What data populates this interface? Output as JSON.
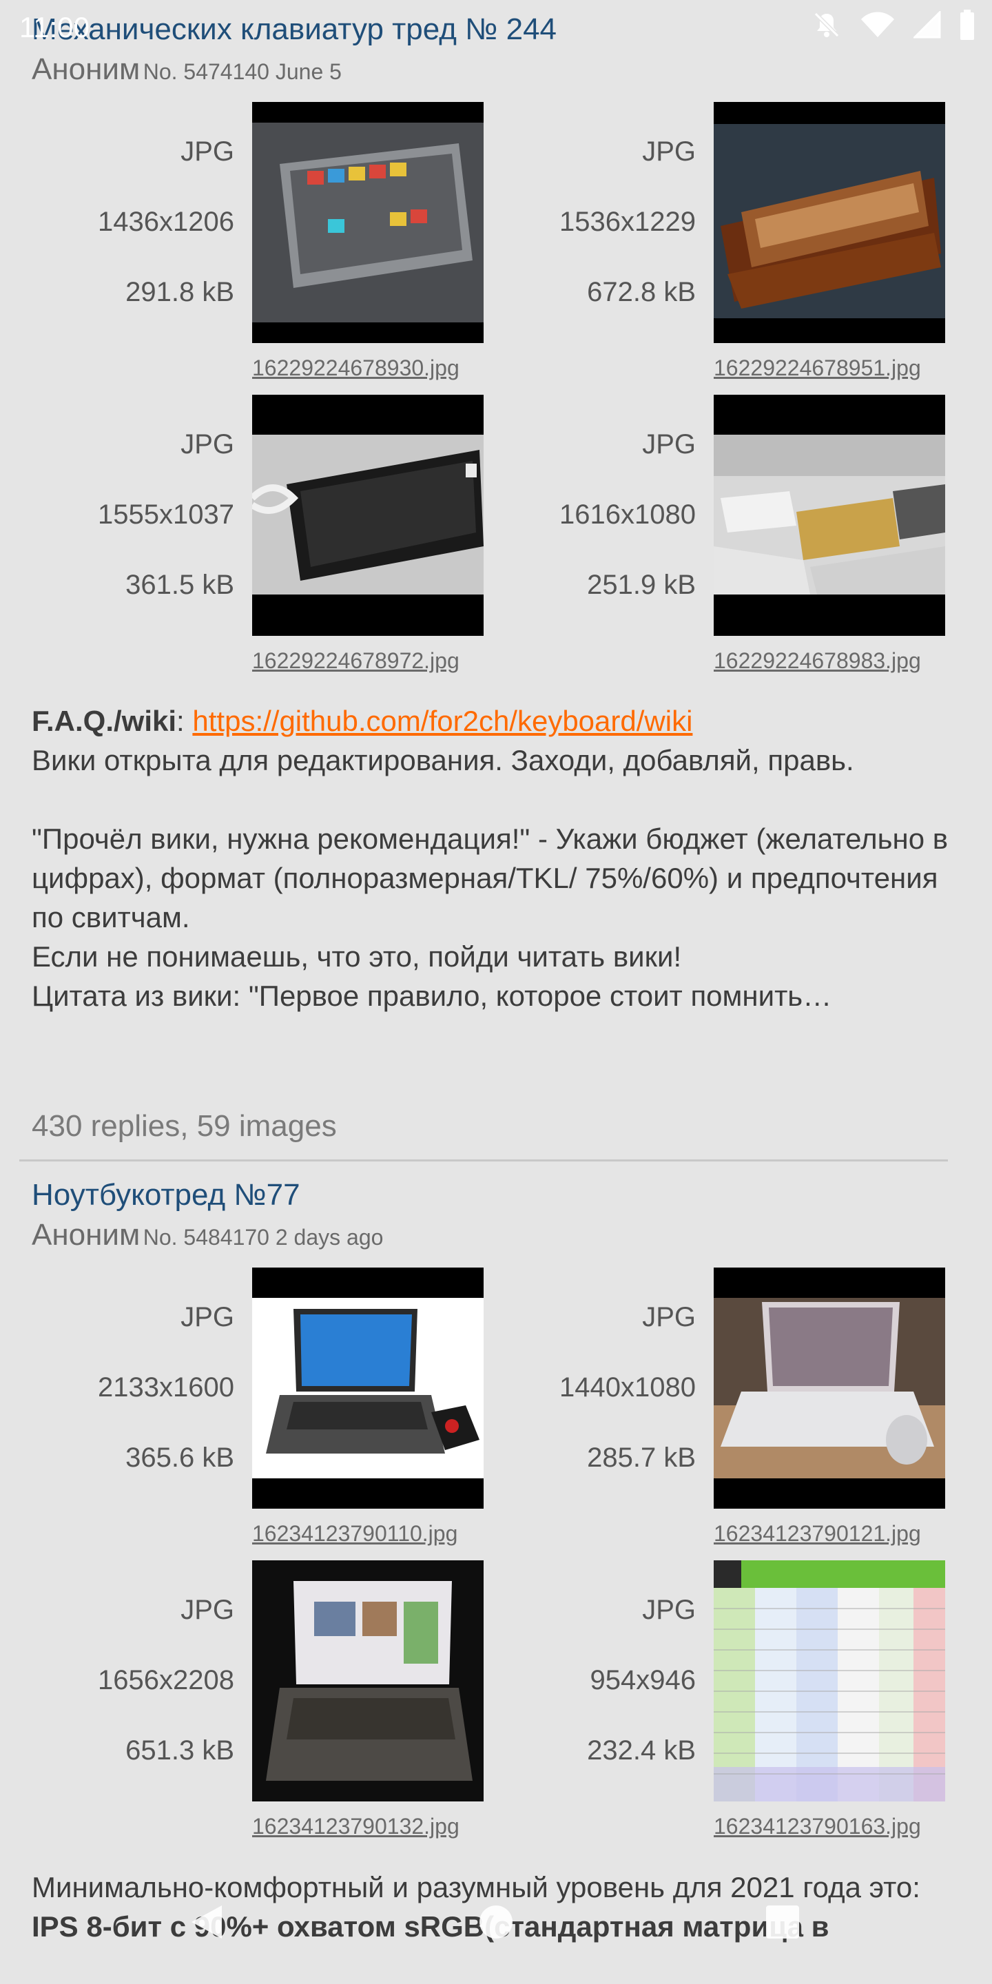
{
  "status": {
    "time": "11:00"
  },
  "threads": [
    {
      "title": "Механических клавиатур тред № 244",
      "author": "Аноним",
      "meta": "No. 5474140 June 5",
      "attachments": [
        {
          "type": "JPG",
          "dims": "1436x1206",
          "size": "291.8 kB",
          "filename": "16229224678930.jpg"
        },
        {
          "type": "JPG",
          "dims": "1536x1229",
          "size": "672.8 kB",
          "filename": "16229224678951.jpg"
        },
        {
          "type": "JPG",
          "dims": "1555x1037",
          "size": "361.5 kB",
          "filename": "16229224678972.jpg"
        },
        {
          "type": "JPG",
          "dims": "1616x1080",
          "size": "251.9 kB",
          "filename": "16229224678983.jpg"
        }
      ],
      "body": {
        "faq_label": "F.A.Q./wiki",
        "faq_sep": ": ",
        "faq_link": "https://github.com/for2ch/keyboard/wiki",
        "line2": "Вики открыта для редактирования. Заходи, добавляй, правь.",
        "para2": "\"Прочёл вики, нужна рекомендация!\" - Укажи бюджет (желательно в цифрах), формат (полноразмерная/TKL/ 75%/60%) и предпочтения по свитчам.",
        "line4": "Если не понимаешь, что это, пойди читать вики!",
        "line5": "Цитата из вики: \"Первое правило, которое стоит помнить…"
      },
      "replies": "430 replies, 59 images"
    },
    {
      "title": "Ноутбукотред №77",
      "author": "Аноним",
      "meta": "No. 5484170 2 days ago",
      "attachments": [
        {
          "type": "JPG",
          "dims": "2133x1600",
          "size": "365.6 kB",
          "filename": "16234123790110.jpg"
        },
        {
          "type": "JPG",
          "dims": "1440x1080",
          "size": "285.7 kB",
          "filename": "16234123790121.jpg"
        },
        {
          "type": "JPG",
          "dims": "1656x2208",
          "size": "651.3 kB",
          "filename": "16234123790132.jpg"
        },
        {
          "type": "JPG",
          "dims": "954x946",
          "size": "232.4 kB",
          "filename": "16234123790163.jpg"
        }
      ],
      "body": {
        "line1": "Минимально-комфортный и разумный уровень для 2021 года это:",
        "line2": "IPS 8-бит с 90%+ охватом sRGB(стандартная матрица в"
      }
    }
  ]
}
